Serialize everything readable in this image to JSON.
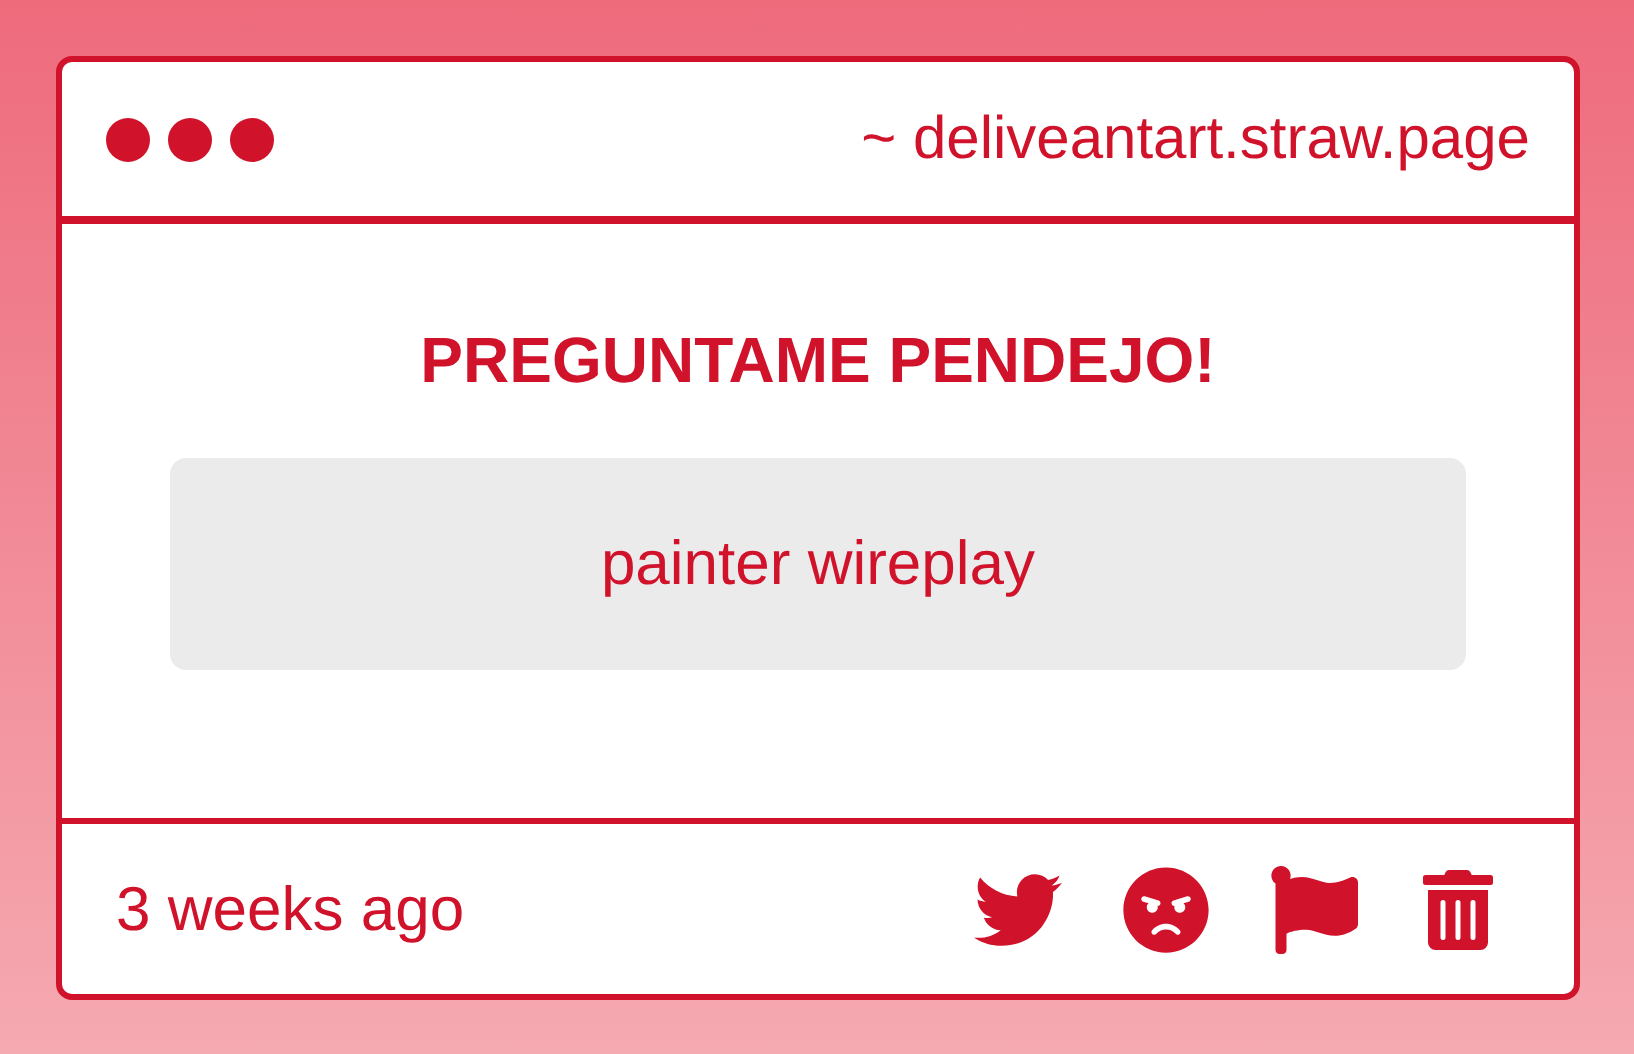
{
  "window": {
    "url": "~ deliveantart.straw.page"
  },
  "card": {
    "title": "PREGUNTAME PENDEJO!",
    "message": "painter wireplay"
  },
  "footer": {
    "time": "3 weeks ago"
  }
}
